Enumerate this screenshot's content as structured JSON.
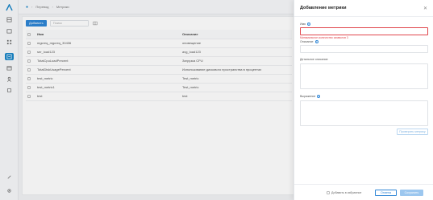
{
  "breadcrumb": [
    "Перевод",
    "Метрики"
  ],
  "toolbar": {
    "add_label": "Добавить",
    "search_placeholder": "Поиск"
  },
  "table": {
    "columns": [
      "Имя",
      "Описание"
    ],
    "rows": [
      {
        "name": "mgcreq_mgcreq_30436",
        "desc": "оповещение"
      },
      {
        "name": "ser_load123",
        "desc": "avg_load123"
      },
      {
        "name": "TotalCpuLoadPercent",
        "desc": "Загрузка CPU"
      },
      {
        "name": "TotalDiskUsagePercent",
        "desc": "Использование дискового пространства в процентах"
      },
      {
        "name": "test_metric",
        "desc": "Test_metric"
      },
      {
        "name": "test_metric1",
        "desc": "Test_metric"
      },
      {
        "name": "test",
        "desc": "test"
      }
    ]
  },
  "drawer": {
    "title": "Добавление метрики",
    "name_label": "Имя",
    "name_error": "Минимальное количество символов 3",
    "desc_label": "Описание",
    "long_desc_label": "Детальное описание",
    "expr_label": "Выражение",
    "check_button": "Проверить метрику",
    "add_to_favorites": "Добавить в избранное",
    "cancel": "Отмена",
    "save": "Сохранить"
  },
  "colors": {
    "accent": "#2f86d6",
    "error": "#e0454b",
    "nav_active": "#1a86c8"
  },
  "icons": [
    "logo-icon",
    "dashboard-icon",
    "chart-icon",
    "grid-icon",
    "metrics-icon",
    "calendar-icon",
    "user-icon",
    "settings-icon",
    "help-icon",
    "gear-icon",
    "close-icon",
    "columns-icon",
    "info-icon"
  ]
}
